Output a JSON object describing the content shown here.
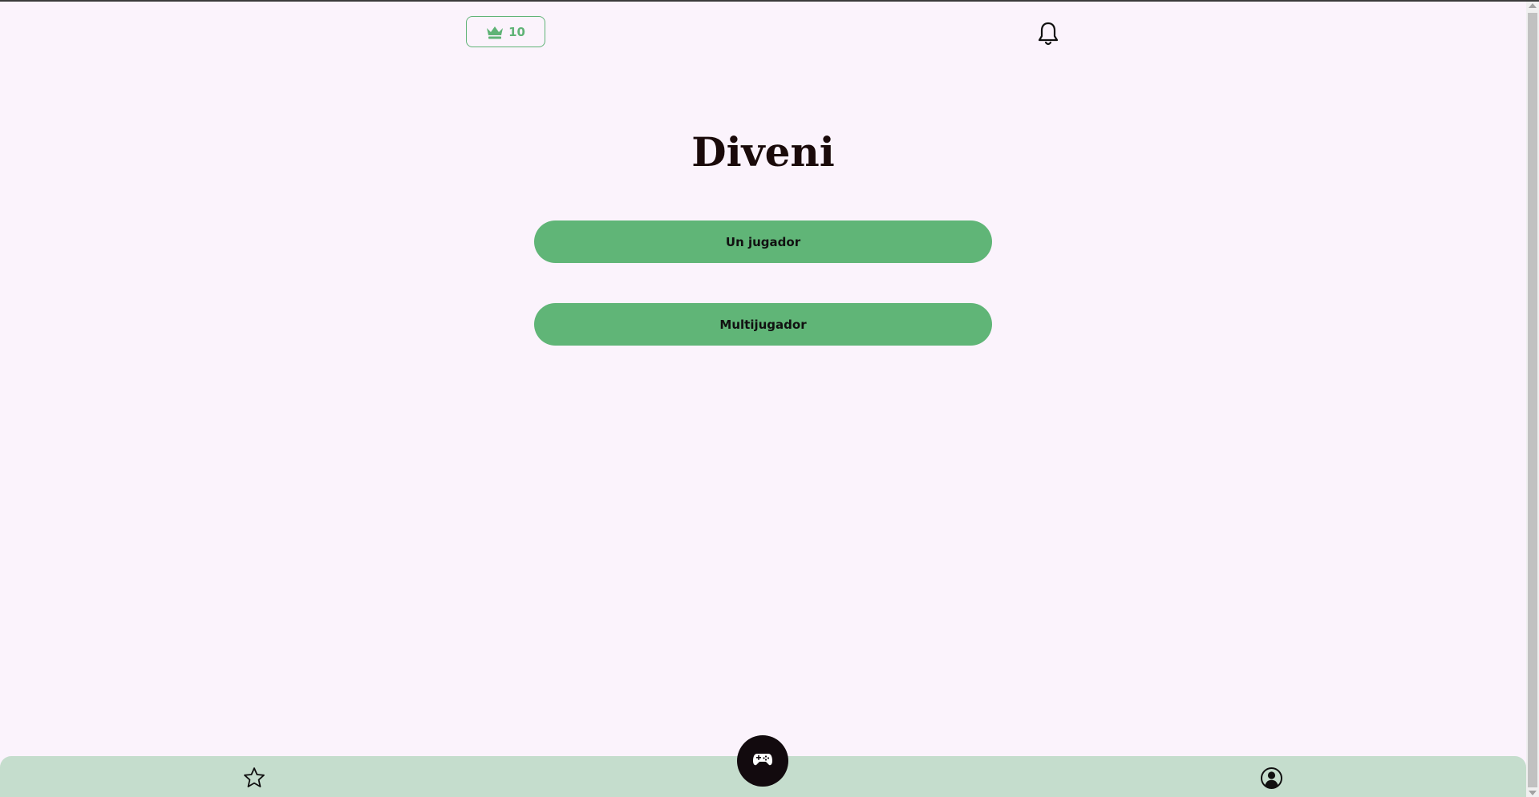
{
  "header": {
    "points_value": "10",
    "points_icon": "crown-icon",
    "notifications_icon": "bell-icon"
  },
  "main": {
    "title": "Diveni",
    "buttons": {
      "single_player": "Un jugador",
      "multiplayer": "Multijugador"
    }
  },
  "bottom_nav": {
    "items": [
      {
        "icon": "star-icon"
      },
      {
        "icon": "gamepad-icon"
      },
      {
        "icon": "user-circle-icon"
      }
    ]
  },
  "colors": {
    "background": "#fbf3fc",
    "accent_green": "#60b577",
    "nav_background": "#c5ddcd",
    "play_button": "#120a0e",
    "title_text": "#1a0a0a"
  }
}
